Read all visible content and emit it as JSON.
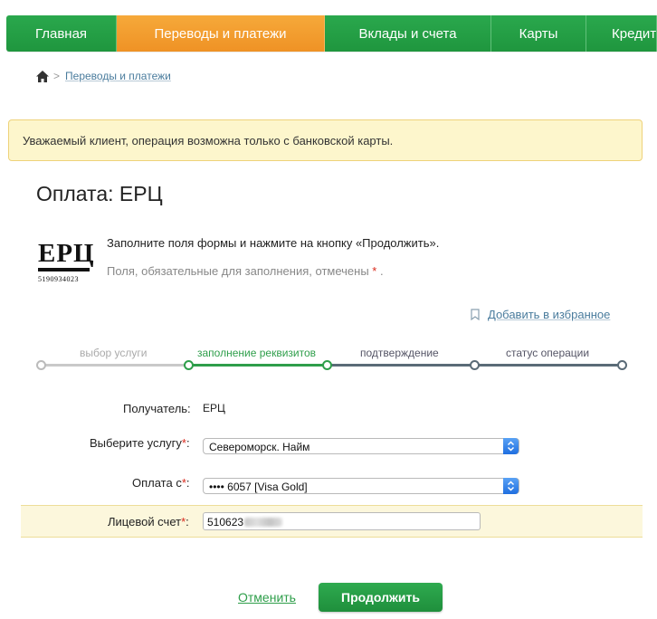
{
  "nav": {
    "items": [
      {
        "label": "Главная"
      },
      {
        "label": "Переводы и платежи",
        "active": true
      },
      {
        "label": "Вклады и счета"
      },
      {
        "label": "Карты"
      },
      {
        "label": "Кредиты"
      }
    ]
  },
  "breadcrumb": {
    "current": "Переводы и платежи"
  },
  "notice": {
    "text": "Уважаемый клиент, операция возможна только с банковской карты."
  },
  "page": {
    "title": "Оплата: ЕРЦ"
  },
  "provider_logo": {
    "name": "ЕРЦ",
    "code": "5190934023"
  },
  "instructions": {
    "main": "Заполните поля формы и нажмите на кнопку «Продолжить».",
    "required_note": "Поля, обязательные для заполнения, отмечены",
    "required_mark": "*",
    "period": "."
  },
  "favorites": {
    "label": "Добавить в избранное"
  },
  "steps": [
    {
      "label": "выбор услуги",
      "state": "done"
    },
    {
      "label": "заполнение реквизитов",
      "state": "current"
    },
    {
      "label": "подтверждение",
      "state": "pending"
    },
    {
      "label": "статус операции",
      "state": "pending"
    }
  ],
  "form": {
    "recipient": {
      "label": "Получатель:",
      "value": "ЕРЦ"
    },
    "service": {
      "label": "Выберите услугу",
      "suffix": ":",
      "value": "Североморск. Найм"
    },
    "pay_from": {
      "label": "Оплата с",
      "suffix": ":",
      "value": "•••• 6057 [Visa Gold]"
    },
    "account": {
      "label": "Лицевой счет",
      "suffix": ":",
      "value_visible": "510623"
    },
    "required_mark": "*"
  },
  "actions": {
    "cancel": "Отменить",
    "submit": "Продолжить"
  },
  "colors": {
    "brand_green": "#21a038",
    "active_tab": "#f39c2f",
    "notice_bg": "#fdf6cc",
    "link": "#4a7c9d"
  }
}
